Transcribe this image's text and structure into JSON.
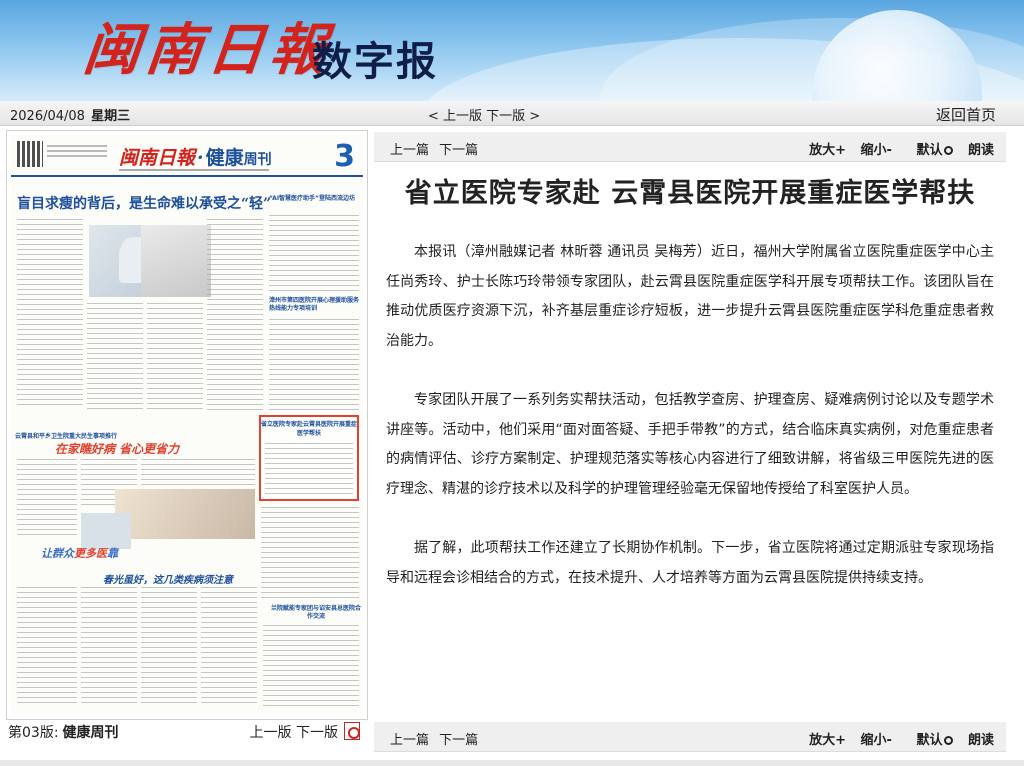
{
  "banner": {
    "logo_text": "闽南日報",
    "subtitle": "数字报"
  },
  "datebar": {
    "date": "2026/04/08",
    "weekday": "星期三",
    "prev_page": "< 上一版",
    "next_page": "下一版 >",
    "home": "返回首页"
  },
  "newspaper": {
    "masthead_title": "闽南日報",
    "masthead_section": "健康",
    "masthead_suffix": "周刊",
    "page_number": "3",
    "headline": "盲目求瘦的背后，是生命难以承受之“轻”",
    "right_title_1": "“AI智慧医疗助手”登陆西流边坊",
    "right_title_2": "漳州市第四医院开展心理援助服务热线能力专项培训",
    "highlight_title": "省立医院专家赴云霄县医院开展重症医学帮扶",
    "banner2_small": "云霄县和平乡卫生院重大民生事项推行",
    "banner2_big": "在家瞧好病 省心更省力",
    "banner3_a": "让群众",
    "banner3_b": "更多医",
    "banner3_c": "靠",
    "spring_title": "春光虽好，这几类疾病须注意",
    "bottom_title": "兰院赋能专家团与诏安县总医院合作交流"
  },
  "page_footer": {
    "edition": "第03版:",
    "edition_name": "健康周刊",
    "prev": "上一版",
    "next": "下一版"
  },
  "toolbar": {
    "prev_article": "上一篇",
    "next_article": "下一篇",
    "zoom_in": "放大+",
    "zoom_out": "缩小-",
    "default": "默认",
    "read": "朗读"
  },
  "article": {
    "title": "省立医院专家赴 云霄县医院开展重症医学帮扶",
    "paragraphs": [
      "本报讯（漳州融媒记者 林昕蓉 通讯员 吴梅芳）近日，福州大学附属省立医院重症医学中心主任尚秀玲、护士长陈巧玲带领专家团队，赴云霄县医院重症医学科开展专项帮扶工作。该团队旨在推动优质医疗资源下沉，补齐基层重症诊疗短板，进一步提升云霄县医院重症医学科危重症患者救治能力。",
      "专家团队开展了一系列务实帮扶活动，包括教学查房、护理查房、疑难病例讨论以及专题学术讲座等。活动中，他们采用“面对面答疑、手把手带教”的方式，结合临床真实病例，对危重症患者的病情评估、诊疗方案制定、护理规范落实等核心内容进行了细致讲解，将省级三甲医院先进的医疗理念、精湛的诊疗技术以及科学的护理管理经验毫无保留地传授给了科室医护人员。",
      "据了解，此项帮扶工作还建立了长期协作机制。下一步，省立医院将通过定期派驻专家现场指导和远程会诊相结合的方式，在技术提升、人才培养等方面为云霄县医院提供持续支持。"
    ]
  }
}
